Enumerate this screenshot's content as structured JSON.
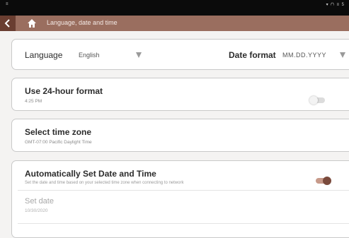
{
  "status_bar": {
    "left": "≡",
    "right": "▾ ⮉ ≡ 5"
  },
  "header": {
    "title": "Language, date and time"
  },
  "language": {
    "label": "Language",
    "value": "English"
  },
  "date_format": {
    "label": "Date format",
    "value": "MM.DD.YYYY"
  },
  "hour24": {
    "title": "Use 24-hour format",
    "subtitle": "4:25 PM",
    "enabled": false
  },
  "timezone": {
    "title": "Select time zone",
    "subtitle": "GMT-07:00 Pacific Daylight Time"
  },
  "auto_datetime": {
    "title": "Automatically Set Date and Time",
    "subtitle": "Set the date and time based on your selected time zone when connecting to network",
    "enabled": true
  },
  "set_date": {
    "title": "Set date",
    "value": "10/30/2020"
  },
  "colors": {
    "title_bar": "#9a6e5f",
    "accent": "#7a4a3c",
    "back_button": "#6a3e31"
  }
}
